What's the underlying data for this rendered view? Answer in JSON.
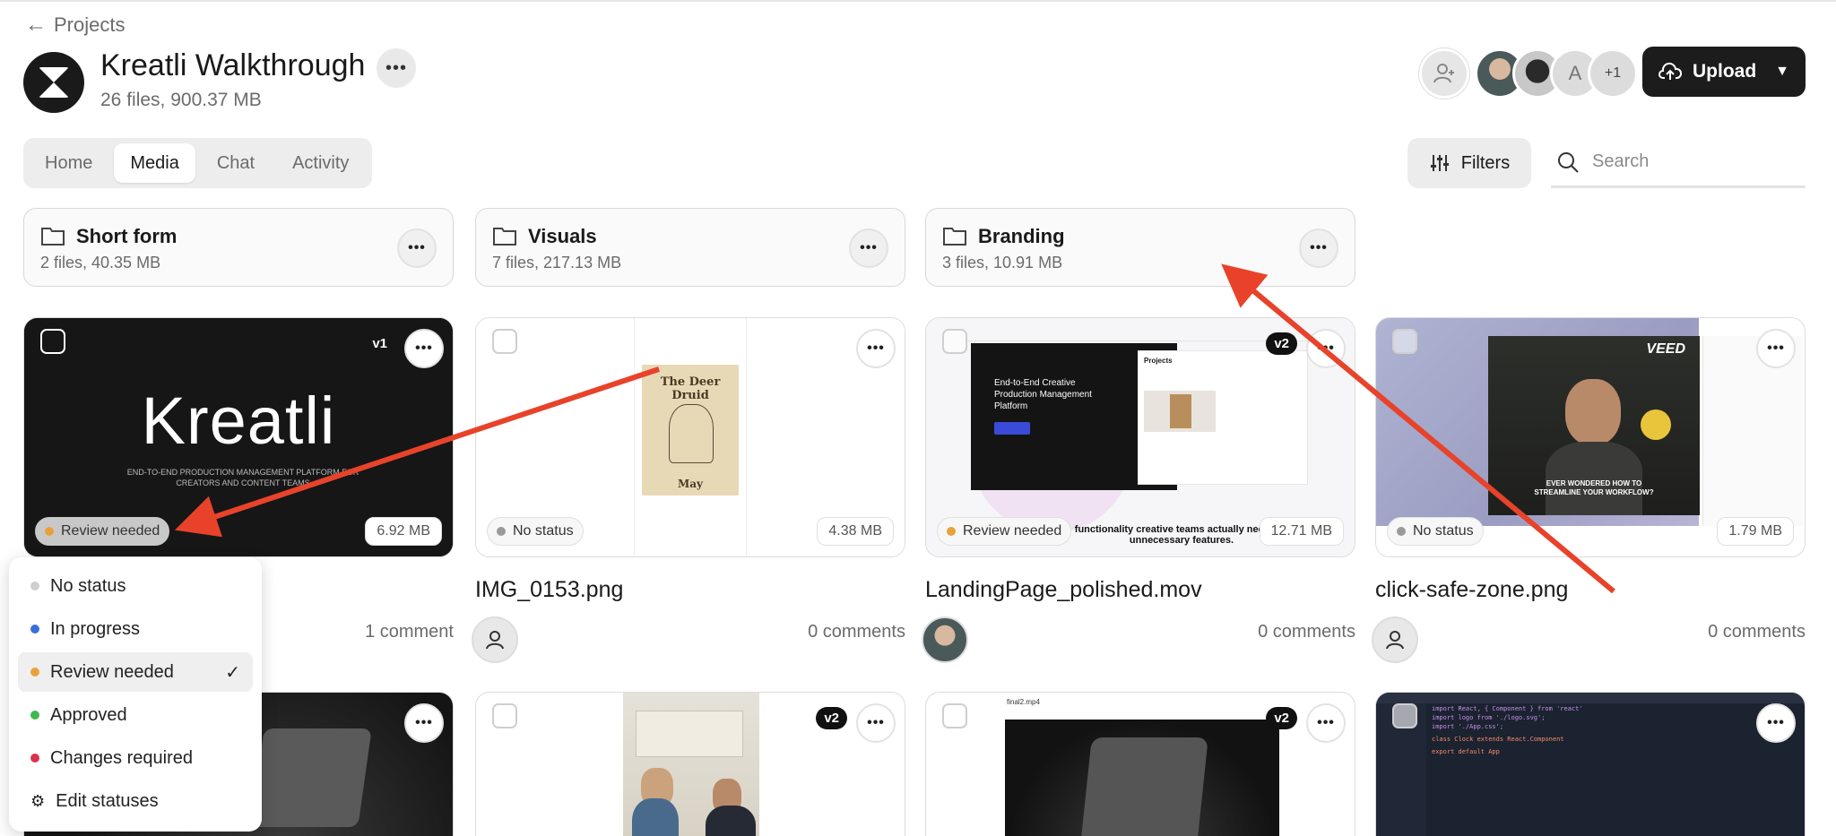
{
  "nav": {
    "back_label": "Projects"
  },
  "project": {
    "title": "Kreatli Walkthrough",
    "subtitle": "26 files, 900.37 MB"
  },
  "members": {
    "letter_avatar": "A",
    "overflow": "+1"
  },
  "upload": {
    "label": "Upload"
  },
  "tabs": [
    {
      "label": "Home",
      "active": false
    },
    {
      "label": "Media",
      "active": true
    },
    {
      "label": "Chat",
      "active": false
    },
    {
      "label": "Activity",
      "active": false
    }
  ],
  "filters": {
    "label": "Filters"
  },
  "search": {
    "placeholder": "Search"
  },
  "folders": [
    {
      "name": "Short form",
      "meta": "2 files, 40.35 MB"
    },
    {
      "name": "Visuals",
      "meta": "7 files, 217.13 MB"
    },
    {
      "name": "Branding",
      "meta": "3 files, 10.91 MB"
    }
  ],
  "files": [
    {
      "name": "",
      "version": "v1",
      "status": "Review needed",
      "size": "6.92 MB",
      "comments": "1 comment",
      "thumb_text": "Kreatli",
      "thumb_sub": "END-TO-END PRODUCTION MANAGEMENT PLATFORM FOR CREATORS AND CONTENT TEAMS"
    },
    {
      "name": "IMG_0153.png",
      "version": "",
      "status": "No status",
      "size": "4.38 MB",
      "comments": "0 comments",
      "thumb_text": "The Deer Druid",
      "thumb_sub": "May"
    },
    {
      "name": "LandingPage_polished.mov",
      "version": "v2",
      "status": "Review needed",
      "size": "12.71 MB",
      "comments": "0 comments",
      "thumb_text": "End-to-End Creative Production Management Platform",
      "thumb_sub": "functionality creative teams actually need. No unnecessary features.",
      "thumb_section": "Projects"
    },
    {
      "name": "click-safe-zone.png",
      "version": "",
      "status": "No status",
      "size": "1.79 MB",
      "comments": "0 comments",
      "thumb_text": "VEED",
      "thumb_sub": "EVER WONDERED HOW TO STREAMLINE YOUR WORKFLOW?"
    }
  ],
  "row2": [
    {
      "version": ""
    },
    {
      "version": "v2"
    },
    {
      "version": "v2",
      "caption": "final2.mp4"
    },
    {
      "version": "",
      "code": [
        "import React, { Component } from 'react'",
        "import logo from './logo.svg';",
        "import './App.css';",
        "class Clock extends React.Component",
        "export default App"
      ]
    }
  ],
  "status_menu": {
    "items": [
      {
        "label": "No status",
        "color": "#cfcfcf",
        "selected": false
      },
      {
        "label": "In progress",
        "color": "#3b6fd9",
        "selected": false
      },
      {
        "label": "Review needed",
        "color": "#e9a23b",
        "selected": true
      },
      {
        "label": "Approved",
        "color": "#3fb950",
        "selected": false
      },
      {
        "label": "Changes required",
        "color": "#d9334f",
        "selected": false
      }
    ],
    "edit_label": "Edit statuses"
  },
  "colors": {
    "accent": "#1c1c1c",
    "annotation": "#e8432a",
    "review": "#e9a23b",
    "no_status": "#9a9a9a"
  }
}
